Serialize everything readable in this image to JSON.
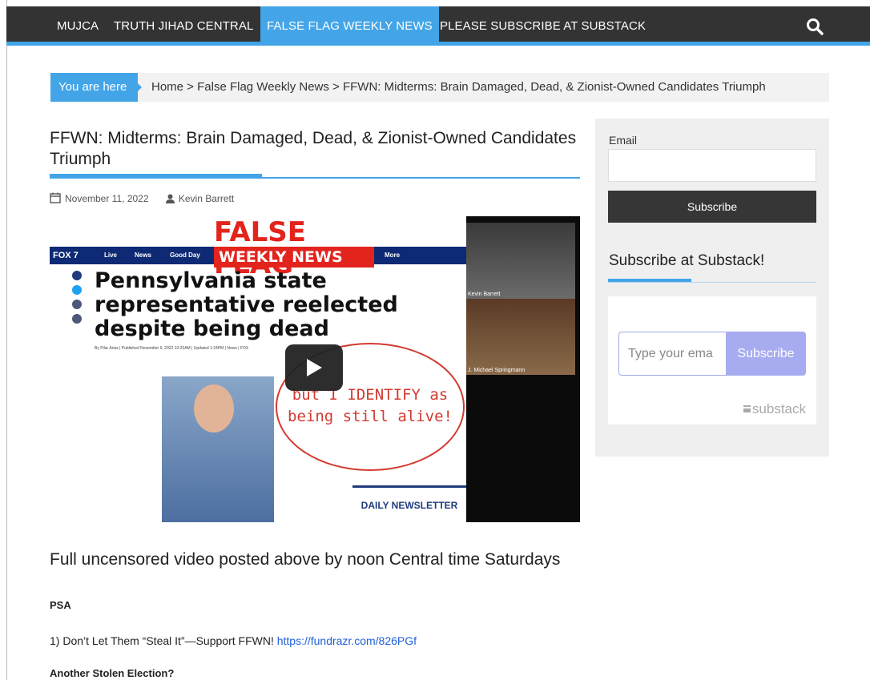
{
  "nav": {
    "items": [
      {
        "label": "MUJCA"
      },
      {
        "label": "TRUTH JIHAD CENTRAL"
      },
      {
        "label": "FALSE FLAG WEEKLY NEWS"
      },
      {
        "label": "PLEASE SUBSCRIBE AT SUBSTACK"
      }
    ],
    "search_icon": "search-icon",
    "accent_color": "#43a5e8",
    "bar_color": "#333333"
  },
  "breadcrumb": {
    "you_are_here": "You are here",
    "path": "Home > False Flag Weekly News > FFWN: Midterms: Brain Damaged, Dead, & Zionist-Owned Candidates Triumph"
  },
  "article": {
    "title": "FFWN: Midterms: Brain Damaged, Dead, & Zionist-Owned Candidates Triumph",
    "date": "November 11, 2022",
    "author": "Kevin Barrett",
    "video": {
      "banner_top": "FALSE FLAG",
      "banner_sub": "WEEKLY NEWS",
      "channel": "FOX 7",
      "tabs": [
        "Live",
        "News",
        "Good Day",
        "More"
      ],
      "headline": "Pennsylvania state representative reelected despite being dead",
      "byline": "By Pilar Arias | Published November 9, 2022 10:23AM | Updated 1:24PM | News | FOX",
      "bubble": "but I IDENTIFY as being still alive!",
      "newsletter": "DAILY NEWSLETTER",
      "cam1_label": "Kevin Barrett",
      "cam2_label": "J. Michael Springmann"
    },
    "subheading": "Full uncensored video posted above by noon Central time Saturdays",
    "psa": "PSA",
    "p1_text": "1) Don’t Let Them “Steal It”—Support FFWN! ",
    "p1_link": "https://fundrazr.com/826PGf",
    "p2": "Another Stolen Election?"
  },
  "sidebar": {
    "email_label": "Email",
    "email_value": "",
    "subscribe_label": "Subscribe",
    "widget_title": "Subscribe at Substack!",
    "substack_placeholder": "Type your ema",
    "substack_button": "Subscribe",
    "substack_brand": "substack"
  }
}
